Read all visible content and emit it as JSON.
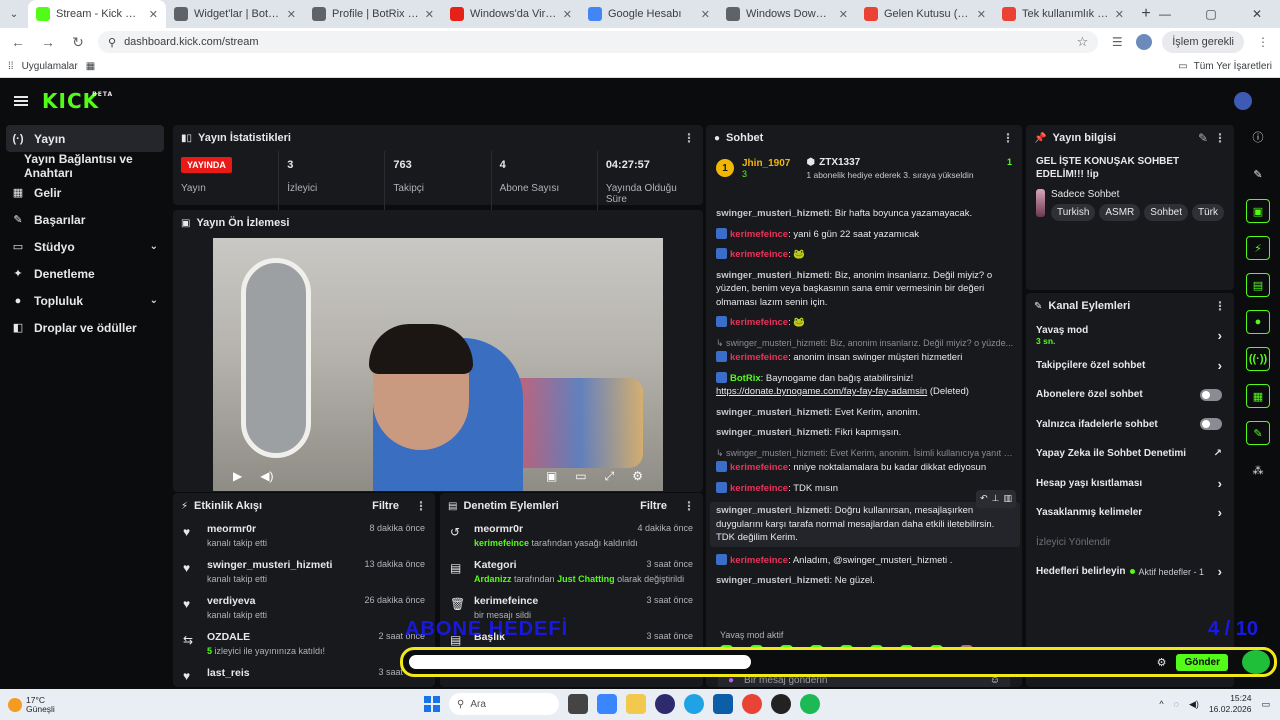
{
  "browser": {
    "tabs": [
      {
        "title": "Stream - Kick Dashboard",
        "color": "#53fc18",
        "active": true
      },
      {
        "title": "Widget'lar | BotRix — Twi",
        "color": "#5f6368",
        "active": false
      },
      {
        "title": "Profile | BotRix — Cloud S",
        "color": "#5f6368",
        "active": false
      },
      {
        "title": "Windows'da Virüsten Kor",
        "color": "#e62117",
        "active": false
      },
      {
        "title": "Google Hesabı",
        "color": "#4285f4",
        "active": false
      },
      {
        "title": "Windows Download - Prin",
        "color": "#5f6368",
        "active": false
      },
      {
        "title": "Gelen Kutusu (5.519) - hir",
        "color": "#ea4335",
        "active": false
      },
      {
        "title": "Tek kullanımlık kodunuz:",
        "color": "#ea4335",
        "active": false
      }
    ],
    "url": "dashboard.kick.com/stream",
    "profile_button": "İşlem gerekli",
    "bookmarks": {
      "apps_label": "Uygulamalar",
      "all_bookmarks": "Tüm Yer İşaretleri"
    }
  },
  "app": {
    "logo": "KICK",
    "logo_badge": "BETA",
    "sidebar": [
      {
        "icon": "(·)",
        "label": "Yayın",
        "active": true,
        "chevron": false,
        "sub": false
      },
      {
        "icon": "",
        "label": "Yayın Bağlantısı ve Anahtarı",
        "active": false,
        "chevron": false,
        "sub": true
      },
      {
        "icon": "▦",
        "label": "Gelir",
        "active": false,
        "chevron": false,
        "sub": false
      },
      {
        "icon": "✎",
        "label": "Başarılar",
        "active": false,
        "chevron": false,
        "sub": false
      },
      {
        "icon": "▭",
        "label": "Stüdyo",
        "active": false,
        "chevron": true,
        "sub": false
      },
      {
        "icon": "✦",
        "label": "Denetleme",
        "active": false,
        "chevron": false,
        "sub": false
      },
      {
        "icon": "●",
        "label": "Topluluk",
        "active": false,
        "chevron": true,
        "sub": false
      },
      {
        "icon": "◧",
        "label": "Droplar ve ödüller",
        "active": false,
        "chevron": false,
        "sub": false
      }
    ],
    "stats_panel": {
      "title": "Yayın İstatistikleri",
      "items": [
        {
          "value": "YAYINDA",
          "label": "Yayın",
          "badge": true
        },
        {
          "value": "3",
          "label": "İzleyici",
          "badge": false
        },
        {
          "value": "763",
          "label": "Takipçi",
          "badge": false
        },
        {
          "value": "4",
          "label": "Abone Sayısı",
          "badge": false
        },
        {
          "value": "04:27:57",
          "label": "Yayında Olduğu Süre",
          "badge": false
        }
      ]
    },
    "preview_panel": {
      "title": "Yayın Ön İzlemesi"
    },
    "activity_panel": {
      "title": "Etkinlik Akışı",
      "filter": "Filtre",
      "items": [
        {
          "icon": "♥",
          "name": "meormr0r",
          "desc": "kanalı takip etti",
          "time": "8 dakika önce"
        },
        {
          "icon": "♥",
          "name": "swinger_musteri_hizmeti",
          "desc": "kanalı takip etti",
          "time": "13 dakika önce"
        },
        {
          "icon": "♥",
          "name": "verdiyeva",
          "desc": "kanalı takip etti",
          "time": "26 dakika önce"
        },
        {
          "icon": "⇆",
          "name": "OZDALE",
          "desc_green": "5",
          "desc": " izleyici ile yayınınıza katıldı!",
          "time": "2 saat önce"
        },
        {
          "icon": "♥",
          "name": "last_reis",
          "desc": "",
          "time": "3 saat önce"
        }
      ]
    },
    "moderation_panel": {
      "title": "Denetim Eylemleri",
      "filter": "Filtre",
      "items": [
        {
          "icon": "↺",
          "name": "meormr0r",
          "desc_green": "kerimefeince",
          "desc": " tarafından yasağı kaldırıldı",
          "time": "4 dakika önce"
        },
        {
          "icon": "▤",
          "name": "Kategori",
          "desc_green": "Ardanizz",
          "desc": " tarafından ",
          "desc_green2": "Just Chatting",
          "desc2": " olarak değiştirildi",
          "time": "3 saat önce"
        },
        {
          "icon": "🗑",
          "name": "kerimefeince",
          "desc": "bir mesajı sildi",
          "time": "3 saat önce"
        },
        {
          "icon": "▤",
          "name": "Başlık",
          "desc": "",
          "time": "3 saat önce"
        }
      ]
    },
    "chat": {
      "title": "Sohbet",
      "top_user": "Jhin_1907",
      "top_user_count": "3",
      "top_rank": "1",
      "gift_user": "ZTX1337",
      "gift_count": "1",
      "gift_text": "1 abonelik hediye ederek 3. sıraya yükseldin",
      "messages": [
        {
          "user": "swinger_musteri_hizmeti",
          "style": "grey",
          "text": ": Bir hafta boyunca yazamayacak."
        },
        {
          "user": "kerimefeince",
          "style": "red",
          "kick": true,
          "text": ": yani 6 gün 22 saat yazamıcak"
        },
        {
          "user": "kerimefeince",
          "style": "red",
          "kick": true,
          "text": ": 🐸"
        },
        {
          "user": "swinger_musteri_hizmeti",
          "style": "grey",
          "text": ": Biz, anonim insanlarız. Değil miyiz? o yüzden, benim veya başkasının sana emir vermesinin bir değeri olmaması lazım senin için."
        },
        {
          "user": "kerimefeince",
          "style": "red",
          "kick": true,
          "text": ": 🐸"
        },
        {
          "reply": "↳ swinger_musteri_hizmeti: Biz, anonim insanlarız. Değil miyiz? o yüzde..."
        },
        {
          "user": "kerimefeince",
          "style": "red",
          "kick": true,
          "text": ": anonim insan swinger müşteri hizmetleri"
        },
        {
          "user": "BotRix",
          "style": "green",
          "kick": true,
          "text": ": Baynogame dan bağış atabilirsiniz! ",
          "link": "https://donate.bynogame.com/fay-fay-fay-adamsin",
          "suffix": " (Deleted)"
        },
        {
          "user": "swinger_musteri_hizmeti",
          "style": "grey",
          "text": ": Evet Kerim, anonim."
        },
        {
          "user": "swinger_musteri_hizmeti",
          "style": "grey",
          "text": ": Fikri kapmışsın."
        },
        {
          "reply": "↳ swinger_musteri_hizmeti: Evet Kerim, anonim. İsimli kullanıcıya yanıt v..."
        },
        {
          "user": "kerimefeince",
          "style": "red",
          "kick": true,
          "text": ": nniye noktalamalara bu kadar dikkat ediyosun"
        },
        {
          "user": "kerimefeince",
          "style": "red",
          "kick": true,
          "text": ": TDK mısın"
        },
        {
          "user": "swinger_musteri_hizmeti",
          "style": "grey",
          "highlight": true,
          "text": ": Doğru kullanırsan, mesajlaşırken duygularını karşı tarafa normal mesajlardan daha etkili iletebilirsin. TDK değilim Kerim."
        },
        {
          "user": "kerimefeince",
          "style": "red",
          "kick": true,
          "text": ": Anladım, @swinger_musteri_hizmeti ."
        },
        {
          "user": "swinger_musteri_hizmeti",
          "style": "grey",
          "text": ": Ne güzel."
        }
      ],
      "slow_mode": "Yavaş mod aktif",
      "input_placeholder": "Bir mesaj gönderin"
    },
    "info_panel": {
      "title": "Yayın bilgisi",
      "stream_title": "GEL İŞTE KONUŞAK SOHBET EDELİM!!! !ip",
      "category": "Sadece Sohbet",
      "tags": [
        "Turkish",
        "ASMR",
        "Sohbet",
        "Türk"
      ]
    },
    "actions_panel": {
      "title": "Kanal Eylemleri",
      "items": [
        {
          "label": "Yavaş mod",
          "sub": "3 sn.",
          "control": "arrow"
        },
        {
          "label": "Takipçilere özel sohbet",
          "sub": "",
          "control": "arrow"
        },
        {
          "label": "Abonelere özel sohbet",
          "sub": "",
          "control": "toggle"
        },
        {
          "label": "Yalnızca ifadelerle sohbet",
          "sub": "",
          "control": "toggle"
        },
        {
          "label": "Yapay Zeka ile Sohbet Denetimi",
          "sub": "",
          "control": "external"
        },
        {
          "label": "Hesap yaşı kısıtlaması",
          "sub": "",
          "control": "arrow"
        },
        {
          "label": "Yasaklanmış kelimeler",
          "sub": "",
          "control": "arrow"
        },
        {
          "label": "İzleyici Yönlendir",
          "sub": "",
          "control": "none",
          "dim": true
        },
        {
          "label": "Hedefleri belirleyin",
          "sub": "",
          "control": "arrow",
          "goal": "Aktif hedefler - 1"
        }
      ]
    }
  },
  "overlay": {
    "goal_label": "ABONE HEDEFİ",
    "goal_count": "4 / 10",
    "send_label": "Gönder"
  },
  "taskbar": {
    "temperature": "17°C",
    "weather": "Güneşli",
    "search_label": "Ara",
    "time": "15:24",
    "date": "16.02.2026"
  }
}
